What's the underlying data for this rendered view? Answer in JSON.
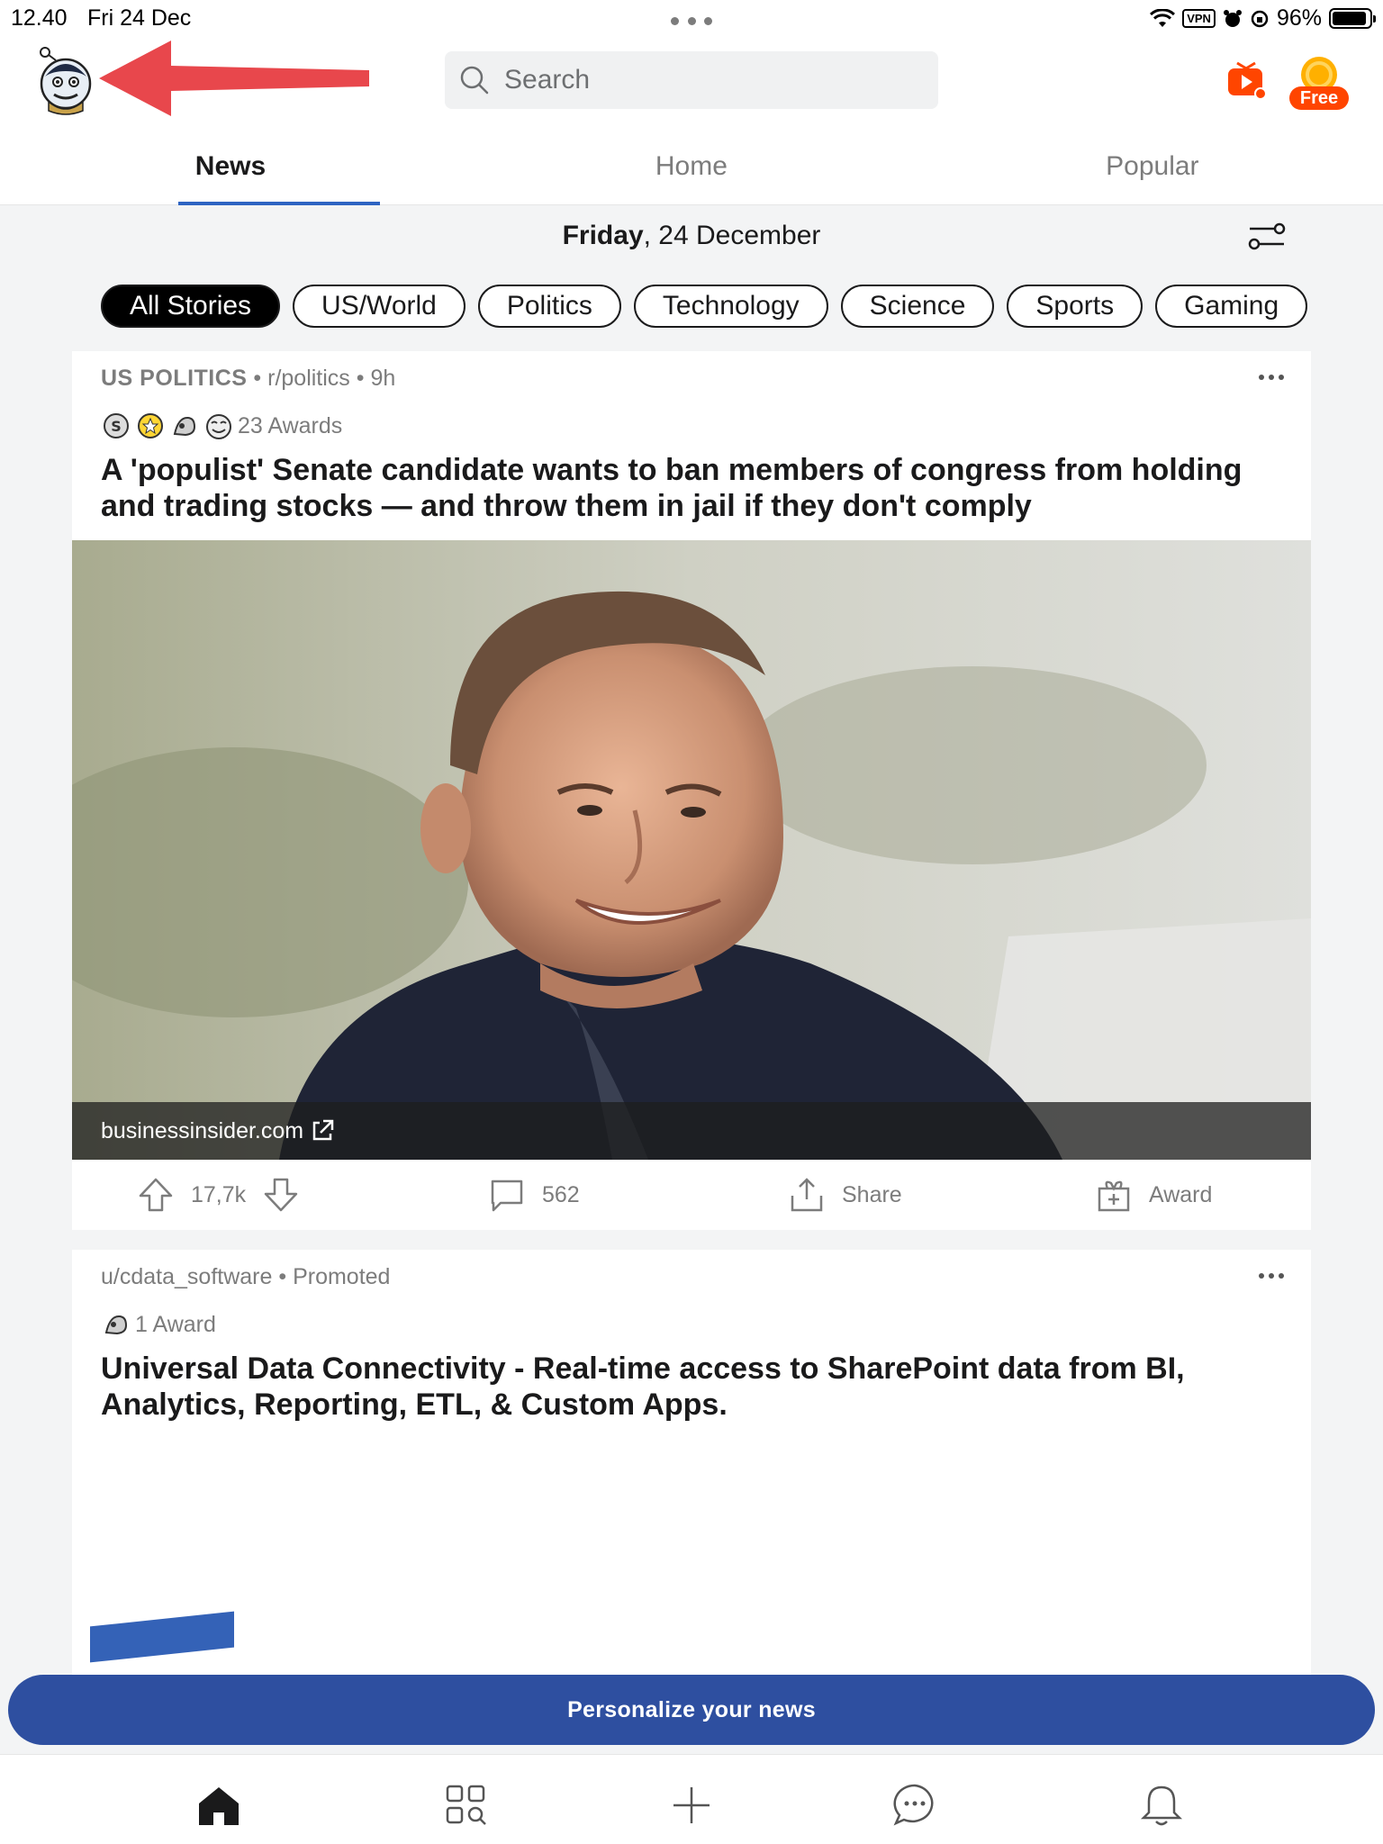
{
  "status_bar": {
    "time": "12.40",
    "date": "Fri 24 Dec",
    "vpn": "VPN",
    "battery": "96%"
  },
  "header": {
    "search_placeholder": "Search",
    "free_badge": "Free",
    "tabs": [
      {
        "label": "News",
        "active": true
      },
      {
        "label": "Home",
        "active": false
      },
      {
        "label": "Popular",
        "active": false
      }
    ]
  },
  "date_row": {
    "weekday": "Friday",
    "rest": ", 24 December"
  },
  "chips": [
    "All Stories",
    "US/World",
    "Politics",
    "Technology",
    "Science",
    "Sports",
    "Gaming"
  ],
  "posts": [
    {
      "label": "US POLITICS",
      "subreddit": "r/politics",
      "age": "9h",
      "awards": "23 Awards",
      "title": "A 'populist' Senate candidate wants to ban members of congress from holding and trading stocks — and throw them in jail if they don't comply",
      "link_domain": "businessinsider.com",
      "upvotes": "17,7k",
      "comments": "562",
      "share": "Share",
      "award": "Award"
    },
    {
      "author": "u/cdata_software",
      "promoted": "Promoted",
      "awards": "1 Award",
      "title": "Universal Data Connectivity - Real-time access to SharePoint data from BI, Analytics, Reporting, ETL, & Custom Apps."
    }
  ],
  "personalize_button": "Personalize your news",
  "colors": {
    "accent": "#2e4fa0",
    "tab_underline": "#2e64c2",
    "orange": "#ff4500",
    "arrow": "#e8474c"
  },
  "icons": [
    "home-icon",
    "discover-icon",
    "create-icon",
    "chat-icon",
    "bell-icon"
  ]
}
